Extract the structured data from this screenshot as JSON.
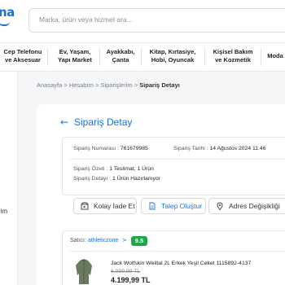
{
  "logo": {
    "text": "na"
  },
  "search": {
    "placeholder": "Marka, ürün veya hizmet ara..."
  },
  "categories": [
    {
      "line1": "Cep Telefonu",
      "line2": "ve Aksesuar"
    },
    {
      "line1": "Ev, Yaşam,",
      "line2": "Yapı Market"
    },
    {
      "line1": "Ayakkabı,",
      "line2": "Çanta"
    },
    {
      "line1": "Kitap, Kırtasiye,",
      "line2": "Hobi, Oyuncak"
    },
    {
      "line1": "Kişisel Bakım",
      "line2": "ve Kozmetik"
    },
    {
      "line1": "Moda",
      "line2": ""
    }
  ],
  "sidebar": {
    "partial_text": "rim"
  },
  "breadcrumb": {
    "items": [
      "Anasayfa",
      "Hesabım",
      "Siparişlerim"
    ],
    "separator": ">",
    "current": "Sipariş Detayı"
  },
  "page": {
    "title": "Sipariş Detay"
  },
  "order": {
    "number_label": "Sipariş Numarası :",
    "number": "761679985",
    "date_label": "Sipariş Tarihi :",
    "date": "14 Ağustos 2024 11:46",
    "summary_label": "Sipariş Özeti :",
    "summary": "1 Teslimat, 1 Ürün",
    "detail_label": "Sipariş Detayı :",
    "detail": "1 Ürün Hazırlanıyor"
  },
  "actions": {
    "easy_return": "Kolay İade Et",
    "create_request": "Talep Oluştur",
    "change_address": "Adres Değişikliği"
  },
  "seller": {
    "label": "Satıcı:",
    "name": "athleticzone",
    "chevron": ">",
    "score": "9.5"
  },
  "product": {
    "name": "Jack Wolfskin Weiltal 2L Erkek Yeşil Ceket 1115892-4137",
    "old_price": "6.999,99 TL",
    "price": "4.199,99 TL"
  },
  "colors": {
    "accent": "#1a6fd8",
    "score_badge": "#1fa64a",
    "page_bg": "#f5f6f8"
  }
}
